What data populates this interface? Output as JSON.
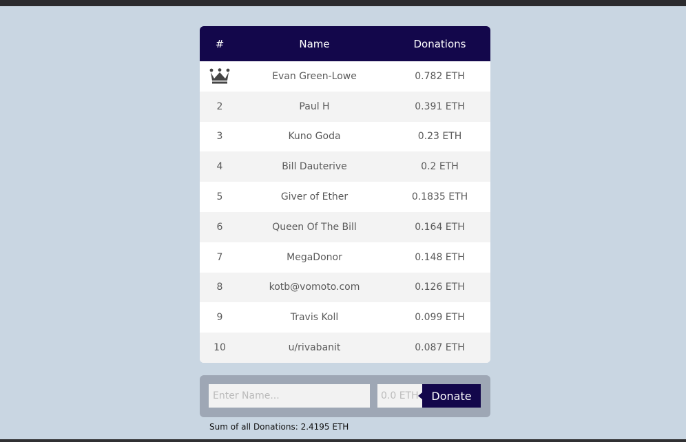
{
  "leaderboard": {
    "headers": {
      "rank": "#",
      "name": "Name",
      "donations": "Donations"
    },
    "top_icon": "crown-icon",
    "rows": [
      {
        "rank": "",
        "name": "Evan Green-Lowe",
        "amount": "0.782 ETH"
      },
      {
        "rank": "2",
        "name": "Paul H",
        "amount": "0.391 ETH"
      },
      {
        "rank": "3",
        "name": "Kuno Goda",
        "amount": "0.23 ETH"
      },
      {
        "rank": "4",
        "name": "Bill Dauterive",
        "amount": "0.2 ETH"
      },
      {
        "rank": "5",
        "name": "Giver of Ether",
        "amount": "0.1835 ETH"
      },
      {
        "rank": "6",
        "name": "Queen Of The Bill",
        "amount": "0.164 ETH"
      },
      {
        "rank": "7",
        "name": "MegaDonor",
        "amount": "0.148 ETH"
      },
      {
        "rank": "8",
        "name": "kotb@vomoto.com",
        "amount": "0.126 ETH"
      },
      {
        "rank": "9",
        "name": "Travis Koll",
        "amount": "0.099 ETH"
      },
      {
        "rank": "10",
        "name": "u/rivabanit",
        "amount": "0.087 ETH"
      }
    ]
  },
  "donate": {
    "name_placeholder": "Enter Name...",
    "name_value": "",
    "amount_placeholder": "0.0 ETH",
    "amount_value": "",
    "button_label": "Donate"
  },
  "footer": {
    "sum_text": "Sum of all Donations: 2.4195 ETH"
  },
  "colors": {
    "background": "#c9d6e2",
    "header": "#13074b",
    "panel": "#9ea7b5"
  }
}
